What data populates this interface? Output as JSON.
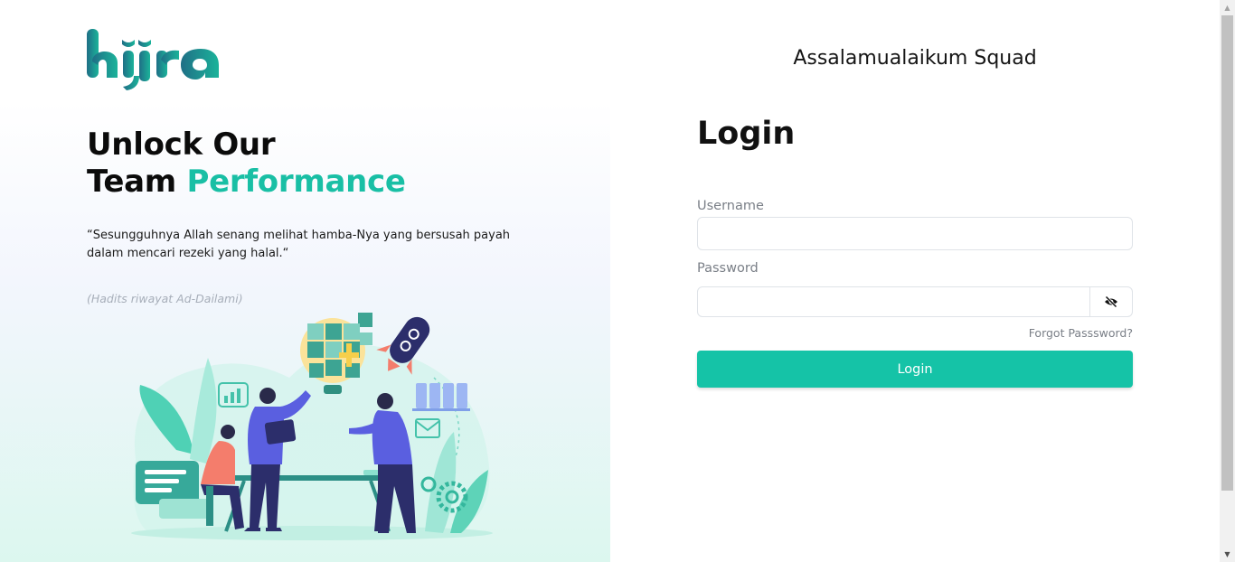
{
  "brand": {
    "logo_text": "hijra",
    "accent_color": "#19bfa5",
    "logo_colors": [
      "#1f6f86",
      "#1bb39a"
    ]
  },
  "hero": {
    "headline_line1": "Unlock Our",
    "headline_team": "Team",
    "headline_accent": "Performance",
    "quote": "“Sesungguhnya Allah senang melihat hamba-Nya yang bersusah payah dalam mencari rezeki yang halal.“",
    "source": "(Hadits riwayat Ad-Dailami)",
    "illustration": "team-collaboration-illustration"
  },
  "header": {
    "greeting": "Assalamualaikum Squad"
  },
  "login_form": {
    "title": "Login",
    "username_label": "Username",
    "username_value": "",
    "password_label": "Password",
    "password_value": "",
    "toggle_icon": "eye-off-icon",
    "forgot_label": "Forgot Passsword?",
    "submit_label": "Login",
    "button_color": "#15c3a7"
  }
}
